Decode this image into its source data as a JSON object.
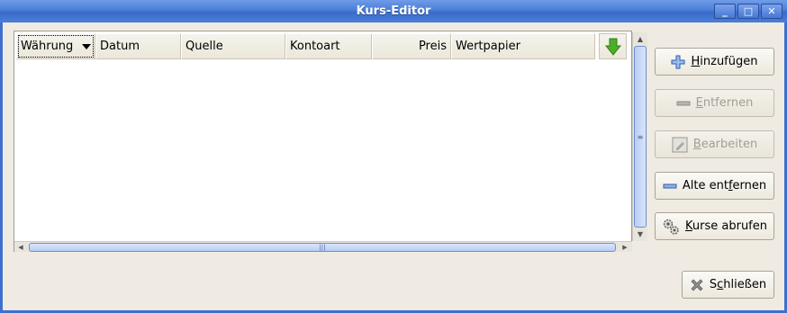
{
  "window": {
    "title": "Kurs-Editor"
  },
  "wm": {
    "minimize": "_",
    "maximize": "□",
    "close": "✕"
  },
  "table": {
    "columns": [
      {
        "label": "Währung"
      },
      {
        "label": "Datum"
      },
      {
        "label": "Quelle"
      },
      {
        "label": "Kontoart"
      },
      {
        "label": "Preis"
      },
      {
        "label": "Wertpapier"
      }
    ],
    "rows": []
  },
  "scrollbar": {
    "v_grip": "≡",
    "h_grip": "|||"
  },
  "buttons": {
    "add": {
      "pre": "",
      "mn": "H",
      "post": "inzufügen"
    },
    "remove": {
      "pre": "",
      "mn": "E",
      "post": "ntfernen"
    },
    "edit": {
      "pre": "",
      "mn": "B",
      "post": "earbeiten"
    },
    "remove_old": {
      "pre": "Alte ent",
      "mn": "f",
      "post": "ernen"
    },
    "fetch": {
      "pre": "",
      "mn": "K",
      "post": "urse abrufen"
    },
    "close": {
      "pre": "S",
      "mn": "c",
      "post": "hließen"
    }
  },
  "icons": {
    "add": "plus-icon",
    "remove": "minus-icon",
    "edit": "edit-icon",
    "remove_old": "minus-icon",
    "fetch": "gears-icon",
    "close": "close-x-icon",
    "download": "green-down-arrow-icon"
  },
  "colors": {
    "accent": "#3d6fd0",
    "download_arrow": "#4caf2a"
  }
}
